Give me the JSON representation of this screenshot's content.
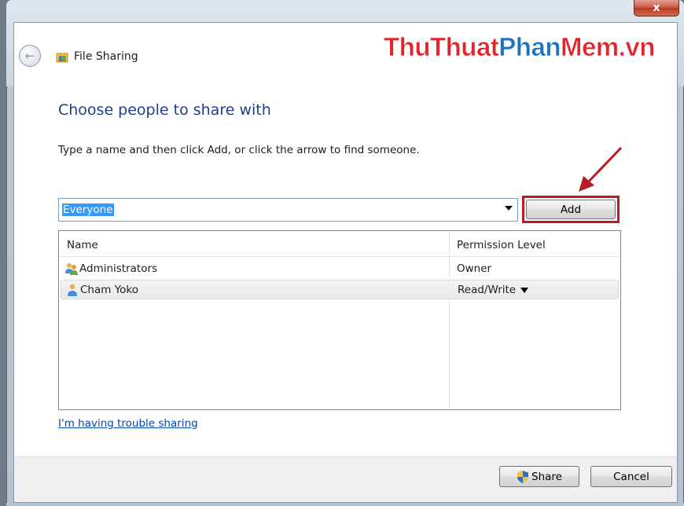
{
  "window": {
    "title": "File Sharing",
    "close_label": "x"
  },
  "watermark": {
    "part1": "ThuThuat",
    "part2": "Phan",
    "part3": "Mem.vn"
  },
  "heading": "Choose people to share with",
  "instruction": "Type a name and then click Add, or click the arrow to find someone.",
  "name_input": {
    "value": "Everyone"
  },
  "add_button": {
    "label": "Add"
  },
  "list": {
    "columns": [
      "Name",
      "Permission Level"
    ],
    "rows": [
      {
        "name": "Administrators",
        "permission": "Owner",
        "icon": "group-users-icon"
      },
      {
        "name": "Cham Yoko",
        "permission": "Read/Write",
        "icon": "user-icon",
        "selected": true
      }
    ]
  },
  "trouble_link": "I'm having trouble sharing",
  "buttons": {
    "share": "Share",
    "cancel": "Cancel"
  },
  "colors": {
    "heading": "#1e3e8c",
    "link": "#0645ad",
    "highlight_box": "#b91c24",
    "selection": "#3399ff"
  }
}
